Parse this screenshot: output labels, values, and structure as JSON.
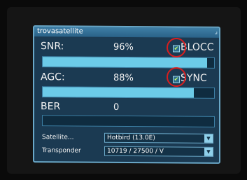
{
  "window": {
    "title": "trovasatellite"
  },
  "meters": [
    {
      "label": "SNR:",
      "value": "96%",
      "level": 0.96,
      "flag_label": "BLOCC",
      "flag_checked": true
    },
    {
      "label": "AGC:",
      "value": "88%",
      "level": 0.88,
      "flag_label": "SYNC",
      "flag_checked": true
    },
    {
      "label": "BER",
      "value": "0",
      "level": 0
    }
  ],
  "fields": [
    {
      "label": "Satellite...",
      "value": "Hotbird (13.0E)"
    },
    {
      "label": "Transponder",
      "value": "10719 / 27500 / V"
    }
  ],
  "icons": {
    "check": "check-icon",
    "dropdown": "chevron-down-icon"
  },
  "colors": {
    "panel": "#1b3a52",
    "bar_fill": "#6ccbe8",
    "annotation_circle": "#d81e1e"
  }
}
